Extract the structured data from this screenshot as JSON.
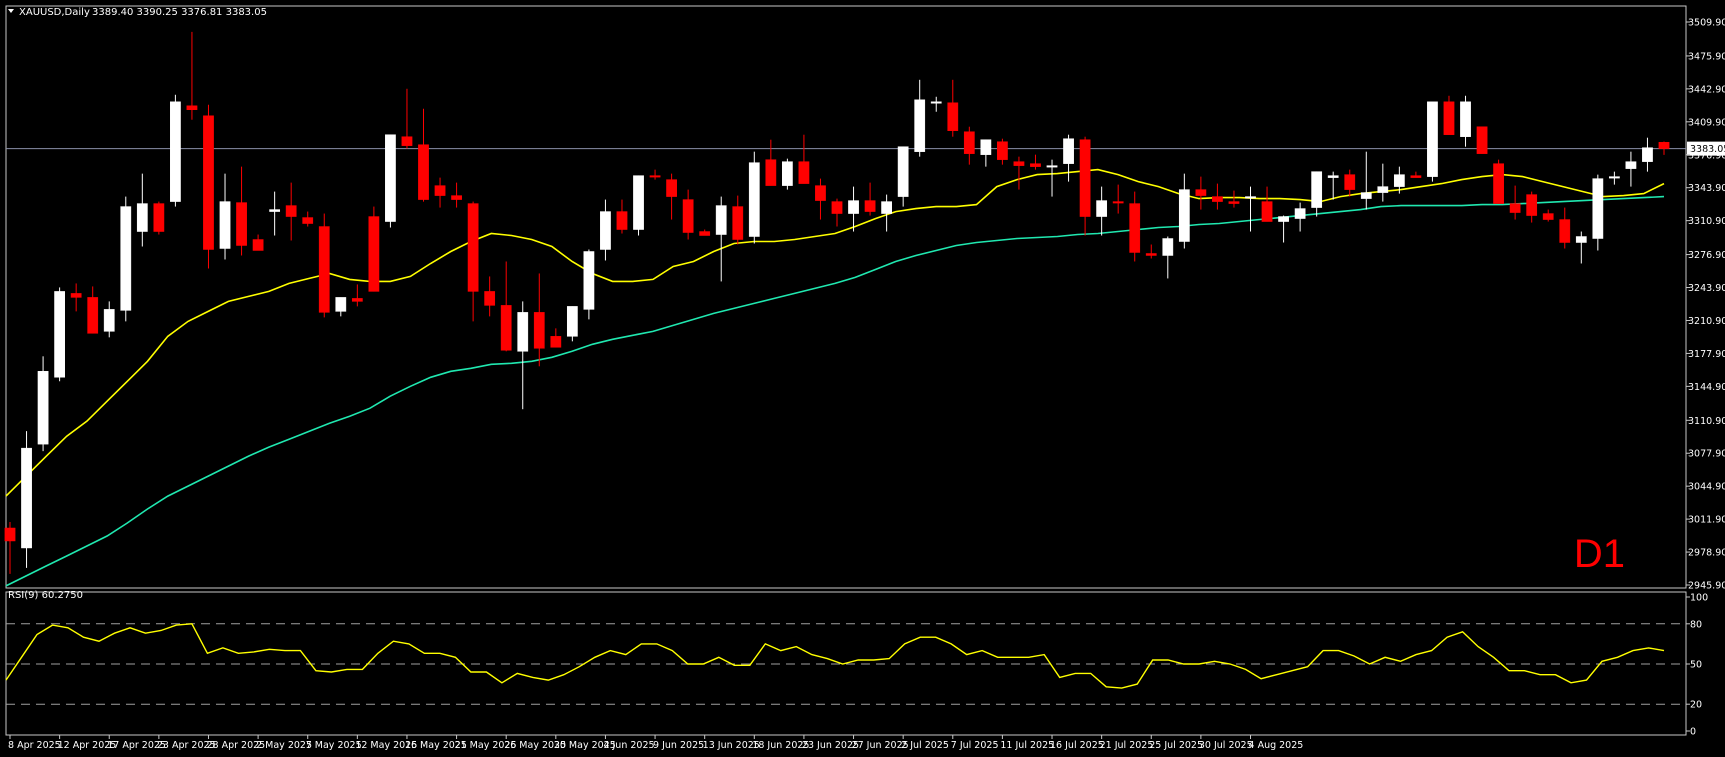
{
  "header": {
    "symbol": "XAUUSD,Daily",
    "ohlc": "3389.40 3390.25 3376.81 3383.05"
  },
  "timeframe_label": "D1",
  "colors": {
    "background": "#000000",
    "frame": "#c8c8c8",
    "bull_candle": "#ffffff",
    "bear_candle": "#ff0000",
    "ma_fast": "#ffff00",
    "ma_slow": "#20e8b0",
    "price_line": "#8a8fa8",
    "rsi_line": "#ffff00",
    "rsi_levels": "#a0a0a0",
    "text": "#ffffff",
    "timeframe": "#ff0000"
  },
  "chart_data": [
    {
      "type": "candlestick",
      "title": "XAUUSD,Daily",
      "y_ticks": [
        "3509.90",
        "3475.90",
        "3442.90",
        "3409.90",
        "3376.90",
        "3343.90",
        "3310.90",
        "3276.90",
        "3243.90",
        "3210.90",
        "3177.90",
        "3144.90",
        "3110.90",
        "3077.90",
        "3044.90",
        "3011.90",
        "2978.90",
        "2945.90"
      ],
      "ylim": [
        2945.9,
        3509.9
      ],
      "current_price": 3383.05,
      "current_price_label": "3383.05",
      "x_ticks": [
        "8 Apr 2025",
        "12 Apr 2025",
        "17 Apr 2025",
        "23 Apr 2025",
        "28 Apr 2025",
        "2 May 2025",
        "7 May 2025",
        "12 May 2025",
        "16 May 2025",
        "21 May 2025",
        "26 May 2025",
        "30 May 2025",
        "4 Jun 2025",
        "9 Jun 2025",
        "13 Jun 2025",
        "18 Jun 2025",
        "23 Jun 2025",
        "27 Jun 2025",
        "2 Jul 2025",
        "7 Jul 2025",
        "11 Jul 2025",
        "16 Jul 2025",
        "21 Jul 2025",
        "25 Jul 2025",
        "30 Jul 2025",
        "4 Aug 2025"
      ],
      "x_tick_index": [
        0,
        3,
        6,
        9,
        12,
        15,
        18,
        21,
        24,
        27,
        30,
        33,
        36,
        39,
        42,
        45,
        48,
        51,
        54,
        57,
        60,
        63,
        66,
        69,
        72,
        75
      ],
      "candles": [
        [
          3003,
          3009,
          2957,
          2990
        ],
        [
          2983,
          3100,
          2963,
          3083
        ],
        [
          3087,
          3175,
          3080,
          3160
        ],
        [
          3154,
          3244,
          3150,
          3240
        ],
        [
          3238,
          3248,
          3220,
          3234
        ],
        [
          3234,
          3245,
          3208,
          3198
        ],
        [
          3200,
          3230,
          3194,
          3222
        ],
        [
          3221,
          3335,
          3210,
          3325
        ],
        [
          3300,
          3358,
          3285,
          3328
        ],
        [
          3328,
          3330,
          3297,
          3300
        ],
        [
          3330,
          3437,
          3325,
          3430
        ],
        [
          3426,
          3500,
          3412,
          3422
        ],
        [
          3416,
          3427,
          3263,
          3282
        ],
        [
          3283,
          3358,
          3272,
          3330
        ],
        [
          3329,
          3365,
          3276,
          3286
        ],
        [
          3292,
          3297,
          3281,
          3281
        ],
        [
          3320,
          3340,
          3296,
          3322
        ],
        [
          3326,
          3349,
          3291,
          3315
        ],
        [
          3314,
          3320,
          3305,
          3308
        ],
        [
          3305,
          3318,
          3214,
          3219
        ],
        [
          3220,
          3232,
          3215,
          3234
        ],
        [
          3233,
          3247,
          3225,
          3230
        ],
        [
          3315,
          3325,
          3260,
          3240
        ],
        [
          3310,
          3395,
          3304,
          3397
        ],
        [
          3395,
          3443,
          3383,
          3386
        ],
        [
          3387,
          3423,
          3330,
          3332
        ],
        [
          3346,
          3354,
          3324,
          3336
        ],
        [
          3336,
          3349,
          3324,
          3332
        ],
        [
          3328,
          3330,
          3210,
          3240
        ],
        [
          3240,
          3255,
          3215,
          3226
        ],
        [
          3226,
          3270,
          3180,
          3181
        ],
        [
          3180,
          3230,
          3122,
          3219
        ],
        [
          3219,
          3258,
          3165,
          3183
        ],
        [
          3195,
          3203,
          3184,
          3184
        ],
        [
          3195,
          3225,
          3190,
          3225
        ],
        [
          3222,
          3282,
          3212,
          3280
        ],
        [
          3282,
          3332,
          3271,
          3320
        ],
        [
          3320,
          3332,
          3298,
          3302
        ],
        [
          3302,
          3350,
          3296,
          3356
        ],
        [
          3356,
          3362,
          3352,
          3355
        ],
        [
          3352,
          3358,
          3312,
          3335
        ],
        [
          3332,
          3342,
          3292,
          3299
        ],
        [
          3300,
          3302,
          3296,
          3296
        ],
        [
          3297,
          3335,
          3250,
          3326
        ],
        [
          3325,
          3336,
          3287,
          3292
        ],
        [
          3295,
          3380,
          3288,
          3369
        ],
        [
          3372,
          3392,
          3360,
          3346
        ],
        [
          3346,
          3373,
          3342,
          3370
        ],
        [
          3370,
          3397,
          3350,
          3348
        ],
        [
          3346,
          3353,
          3312,
          3331
        ],
        [
          3330,
          3333,
          3305,
          3318
        ],
        [
          3318,
          3345,
          3300,
          3331
        ],
        [
          3331,
          3349,
          3316,
          3320
        ],
        [
          3318,
          3337,
          3300,
          3330
        ],
        [
          3335,
          3381,
          3325,
          3385
        ],
        [
          3380,
          3452,
          3375,
          3432
        ],
        [
          3430,
          3435,
          3420,
          3430
        ],
        [
          3429,
          3452,
          3395,
          3401
        ],
        [
          3400,
          3405,
          3367,
          3378
        ],
        [
          3377,
          3392,
          3365,
          3392
        ],
        [
          3390,
          3393,
          3367,
          3372
        ],
        [
          3370,
          3375,
          3342,
          3366
        ],
        [
          3368,
          3377,
          3362,
          3365
        ],
        [
          3365,
          3372,
          3335,
          3366
        ],
        [
          3368,
          3397,
          3350,
          3393
        ],
        [
          3392,
          3395,
          3296,
          3315
        ],
        [
          3315,
          3345,
          3296,
          3331
        ],
        [
          3330,
          3347,
          3318,
          3329
        ],
        [
          3328,
          3340,
          3270,
          3279
        ],
        [
          3278,
          3287,
          3273,
          3276
        ],
        [
          3276,
          3295,
          3253,
          3293
        ],
        [
          3290,
          3358,
          3283,
          3342
        ],
        [
          3342,
          3355,
          3322,
          3336
        ],
        [
          3335,
          3348,
          3322,
          3330
        ],
        [
          3330,
          3341,
          3324,
          3328
        ],
        [
          3335,
          3345,
          3300,
          3335
        ],
        [
          3330,
          3345,
          3317,
          3310
        ],
        [
          3310,
          3316,
          3289,
          3315
        ],
        [
          3313,
          3329,
          3300,
          3323
        ],
        [
          3324,
          3355,
          3315,
          3360
        ],
        [
          3354,
          3360,
          3332,
          3356
        ],
        [
          3357,
          3362,
          3335,
          3342
        ],
        [
          3333,
          3380,
          3322,
          3339
        ],
        [
          3339,
          3368,
          3330,
          3345
        ],
        [
          3345,
          3365,
          3338,
          3357
        ],
        [
          3356,
          3360,
          3354,
          3354
        ],
        [
          3355,
          3420,
          3350,
          3430
        ],
        [
          3430,
          3436,
          3398,
          3397
        ],
        [
          3395,
          3436,
          3385,
          3430
        ],
        [
          3405,
          3390,
          3390,
          3378
        ],
        [
          3368,
          3372,
          3338,
          3328
        ],
        [
          3328,
          3346,
          3312,
          3319
        ],
        [
          3337,
          3340,
          3309,
          3316
        ],
        [
          3318,
          3322,
          3310,
          3312
        ],
        [
          3312,
          3324,
          3283,
          3289
        ],
        [
          3289,
          3300,
          3268,
          3295
        ],
        [
          3293,
          3357,
          3281,
          3353
        ],
        [
          3354,
          3360,
          3347,
          3355
        ],
        [
          3363,
          3380,
          3345,
          3370
        ],
        [
          3370,
          3394,
          3360,
          3384
        ],
        [
          3389.4,
          3390.25,
          3376.81,
          3383.05
        ]
      ],
      "ma_fast": [
        3035,
        3055,
        3075,
        3095,
        3110,
        3130,
        3150,
        3170,
        3195,
        3210,
        3220,
        3230,
        3235,
        3240,
        3248,
        3253,
        3258,
        3252,
        3250,
        3250,
        3255,
        3268,
        3280,
        3290,
        3298,
        3296,
        3292,
        3285,
        3270,
        3258,
        3250,
        3250,
        3252,
        3265,
        3270,
        3280,
        3288,
        3290,
        3290,
        3292,
        3295,
        3298,
        3305,
        3313,
        3320,
        3323,
        3325,
        3325,
        3327,
        3345,
        3352,
        3357,
        3358,
        3360,
        3362,
        3357,
        3350,
        3345,
        3338,
        3333,
        3334,
        3334,
        3333,
        3333,
        3332,
        3330,
        3335,
        3338,
        3340,
        3342,
        3345,
        3348,
        3352,
        3355,
        3357,
        3355,
        3350,
        3345,
        3340,
        3335,
        3336,
        3338,
        3348
      ],
      "ma_slow": [
        2945,
        2955,
        2965,
        2975,
        2985,
        2995,
        3008,
        3022,
        3035,
        3045,
        3055,
        3065,
        3075,
        3084,
        3092,
        3100,
        3108,
        3115,
        3123,
        3135,
        3145,
        3154,
        3160,
        3163,
        3167,
        3168,
        3170,
        3174,
        3180,
        3187,
        3192,
        3196,
        3200,
        3206,
        3212,
        3218,
        3223,
        3228,
        3233,
        3238,
        3243,
        3248,
        3254,
        3262,
        3270,
        3276,
        3281,
        3286,
        3289,
        3291,
        3293,
        3294,
        3295,
        3297,
        3298,
        3300,
        3302,
        3304,
        3305,
        3307,
        3308,
        3310,
        3312,
        3314,
        3316,
        3318,
        3320,
        3322,
        3325,
        3326,
        3326,
        3326,
        3326,
        3327,
        3327,
        3328,
        3329,
        3330,
        3331,
        3332,
        3333,
        3334,
        3335
      ]
    },
    {
      "type": "line",
      "title": "RSI(9) 60.2750",
      "series_name": "RSI(9)",
      "last_value": 60.275,
      "y_ticks": [
        "100",
        "80",
        "50",
        "20",
        "0"
      ],
      "levels": [
        80,
        50,
        20
      ],
      "ylim": [
        0,
        100
      ],
      "values": [
        38,
        55,
        72,
        79,
        77,
        70,
        67,
        73,
        77,
        73,
        75,
        79,
        80,
        58,
        62,
        58,
        59,
        61,
        60,
        60,
        45,
        44,
        46,
        46,
        58,
        67,
        65,
        58,
        58,
        55,
        44,
        44,
        36,
        43,
        40,
        38,
        42,
        48,
        55,
        60,
        57,
        65,
        65,
        60,
        50,
        50,
        55,
        49,
        49,
        65,
        60,
        63,
        57,
        54,
        50,
        53,
        53,
        54,
        65,
        70,
        70,
        65,
        57,
        60,
        55,
        55,
        55,
        57,
        40,
        43,
        43,
        33,
        32,
        35,
        53,
        53,
        50,
        50,
        52,
        50,
        46,
        39,
        42,
        45,
        48,
        60,
        60,
        56,
        50,
        55,
        52,
        57,
        60,
        70,
        74,
        63,
        55,
        45,
        45,
        42,
        42,
        36,
        38,
        52,
        55,
        60,
        62,
        60
      ]
    }
  ]
}
